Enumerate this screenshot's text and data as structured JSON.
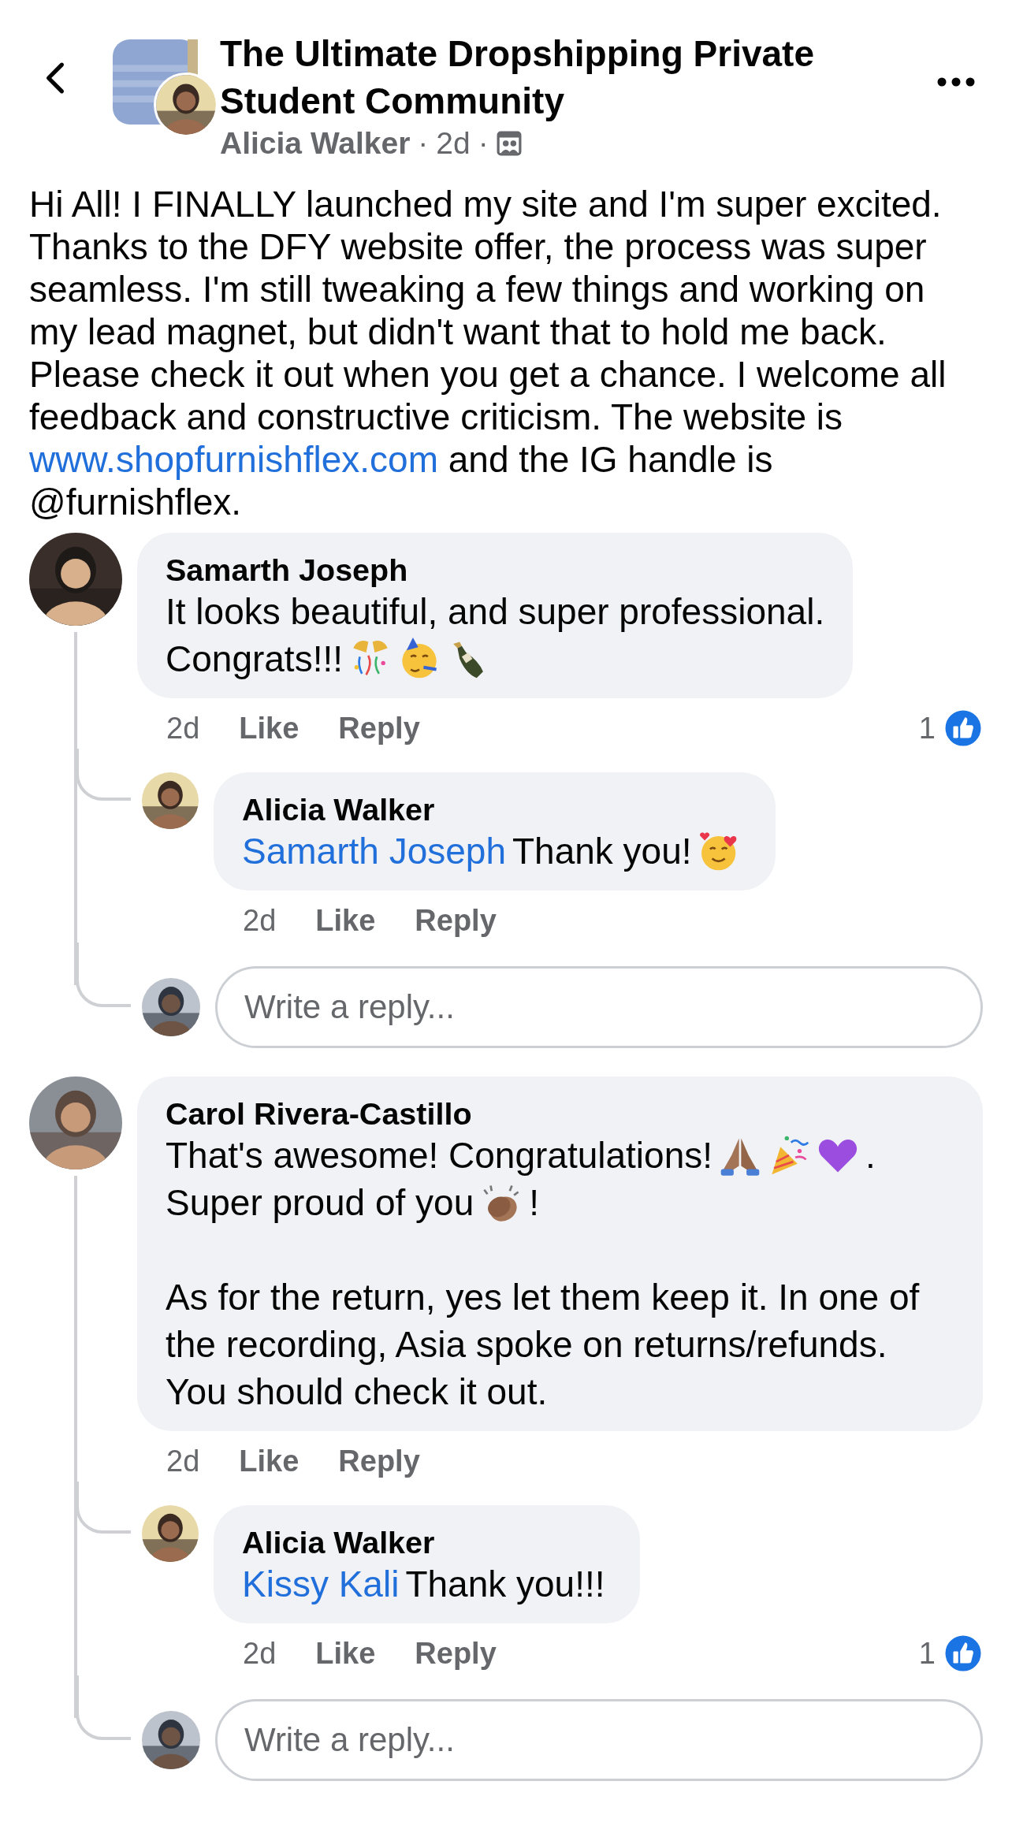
{
  "header": {
    "title": "The Ultimate Dropshipping Private Student Community",
    "author": "Alicia Walker",
    "dot_1": "·",
    "time": "2d",
    "dot_2": "·"
  },
  "post": {
    "body": [
      {
        "kind": "text",
        "text": "Hi All! I FINALLY launched my site and I'm super excited. Thanks to the DFY website offer, the process was super seamless. I'm still tweaking a few things and working on my lead magnet, but didn't want that to hold me back. Please check it out when you get a chance. I welcome all feedback and constructive criticism. The website is"
      },
      {
        "kind": "link",
        "text": "www.shopfurnishflex.com"
      },
      {
        "kind": "text",
        "text": "and the IG handle is @furnishflex."
      }
    ]
  },
  "comments": [
    {
      "name": "Samarth Joseph",
      "paragraphs": [
        {
          "lines": [
            [
              {
                "kind": "text",
                "text": "It looks beautiful, and super professional."
              }
            ],
            [
              {
                "kind": "text",
                "text": "Congrats!!!"
              },
              {
                "kind": "confetti"
              },
              {
                "kind": "partyface"
              },
              {
                "kind": "bottle"
              }
            ]
          ]
        }
      ],
      "time": "2d",
      "like": "Like",
      "reply": "Reply",
      "reactions": "1",
      "replies": [
        {
          "name": "Alicia Walker",
          "paragraphs": [
            {
              "lines": [
                [
                  {
                    "kind": "mention",
                    "text": "Samarth Joseph"
                  },
                  {
                    "kind": "text",
                    "text": "Thank you!"
                  },
                  {
                    "kind": "blush"
                  }
                ]
              ]
            }
          ],
          "time": "2d",
          "like": "Like",
          "reply": "Reply"
        }
      ],
      "reply_field": {
        "placeholder": "Write a reply..."
      }
    },
    {
      "name": "Carol Rivera-Castillo",
      "paragraphs": [
        {
          "lines": [
            [
              {
                "kind": "text",
                "text": "That's awesome! Congratulations!"
              },
              {
                "kind": "hands"
              },
              {
                "kind": "popper"
              },
              {
                "kind": "heart"
              },
              {
                "kind": "text",
                "text": "."
              }
            ],
            [
              {
                "kind": "text",
                "text": "Super proud of you"
              },
              {
                "kind": "clap"
              },
              {
                "kind": "text",
                "text": "!"
              }
            ]
          ]
        },
        {
          "lines": [
            [
              {
                "kind": "text",
                "text": "As for the return, yes let them keep it. In one of the recording, Asia spoke on returns/refunds. You should check it out."
              }
            ]
          ]
        }
      ],
      "time": "2d",
      "like": "Like",
      "reply": "Reply",
      "replies": [
        {
          "name": "Alicia Walker",
          "paragraphs": [
            {
              "lines": [
                [
                  {
                    "kind": "mention",
                    "text": "Kissy Kali"
                  },
                  {
                    "kind": "text",
                    "text": "Thank you!!!"
                  }
                ]
              ]
            }
          ],
          "time": "2d",
          "like": "Like",
          "reply": "Reply",
          "reactions": "1"
        }
      ],
      "reply_field": {
        "placeholder": "Write a reply..."
      }
    }
  ]
}
